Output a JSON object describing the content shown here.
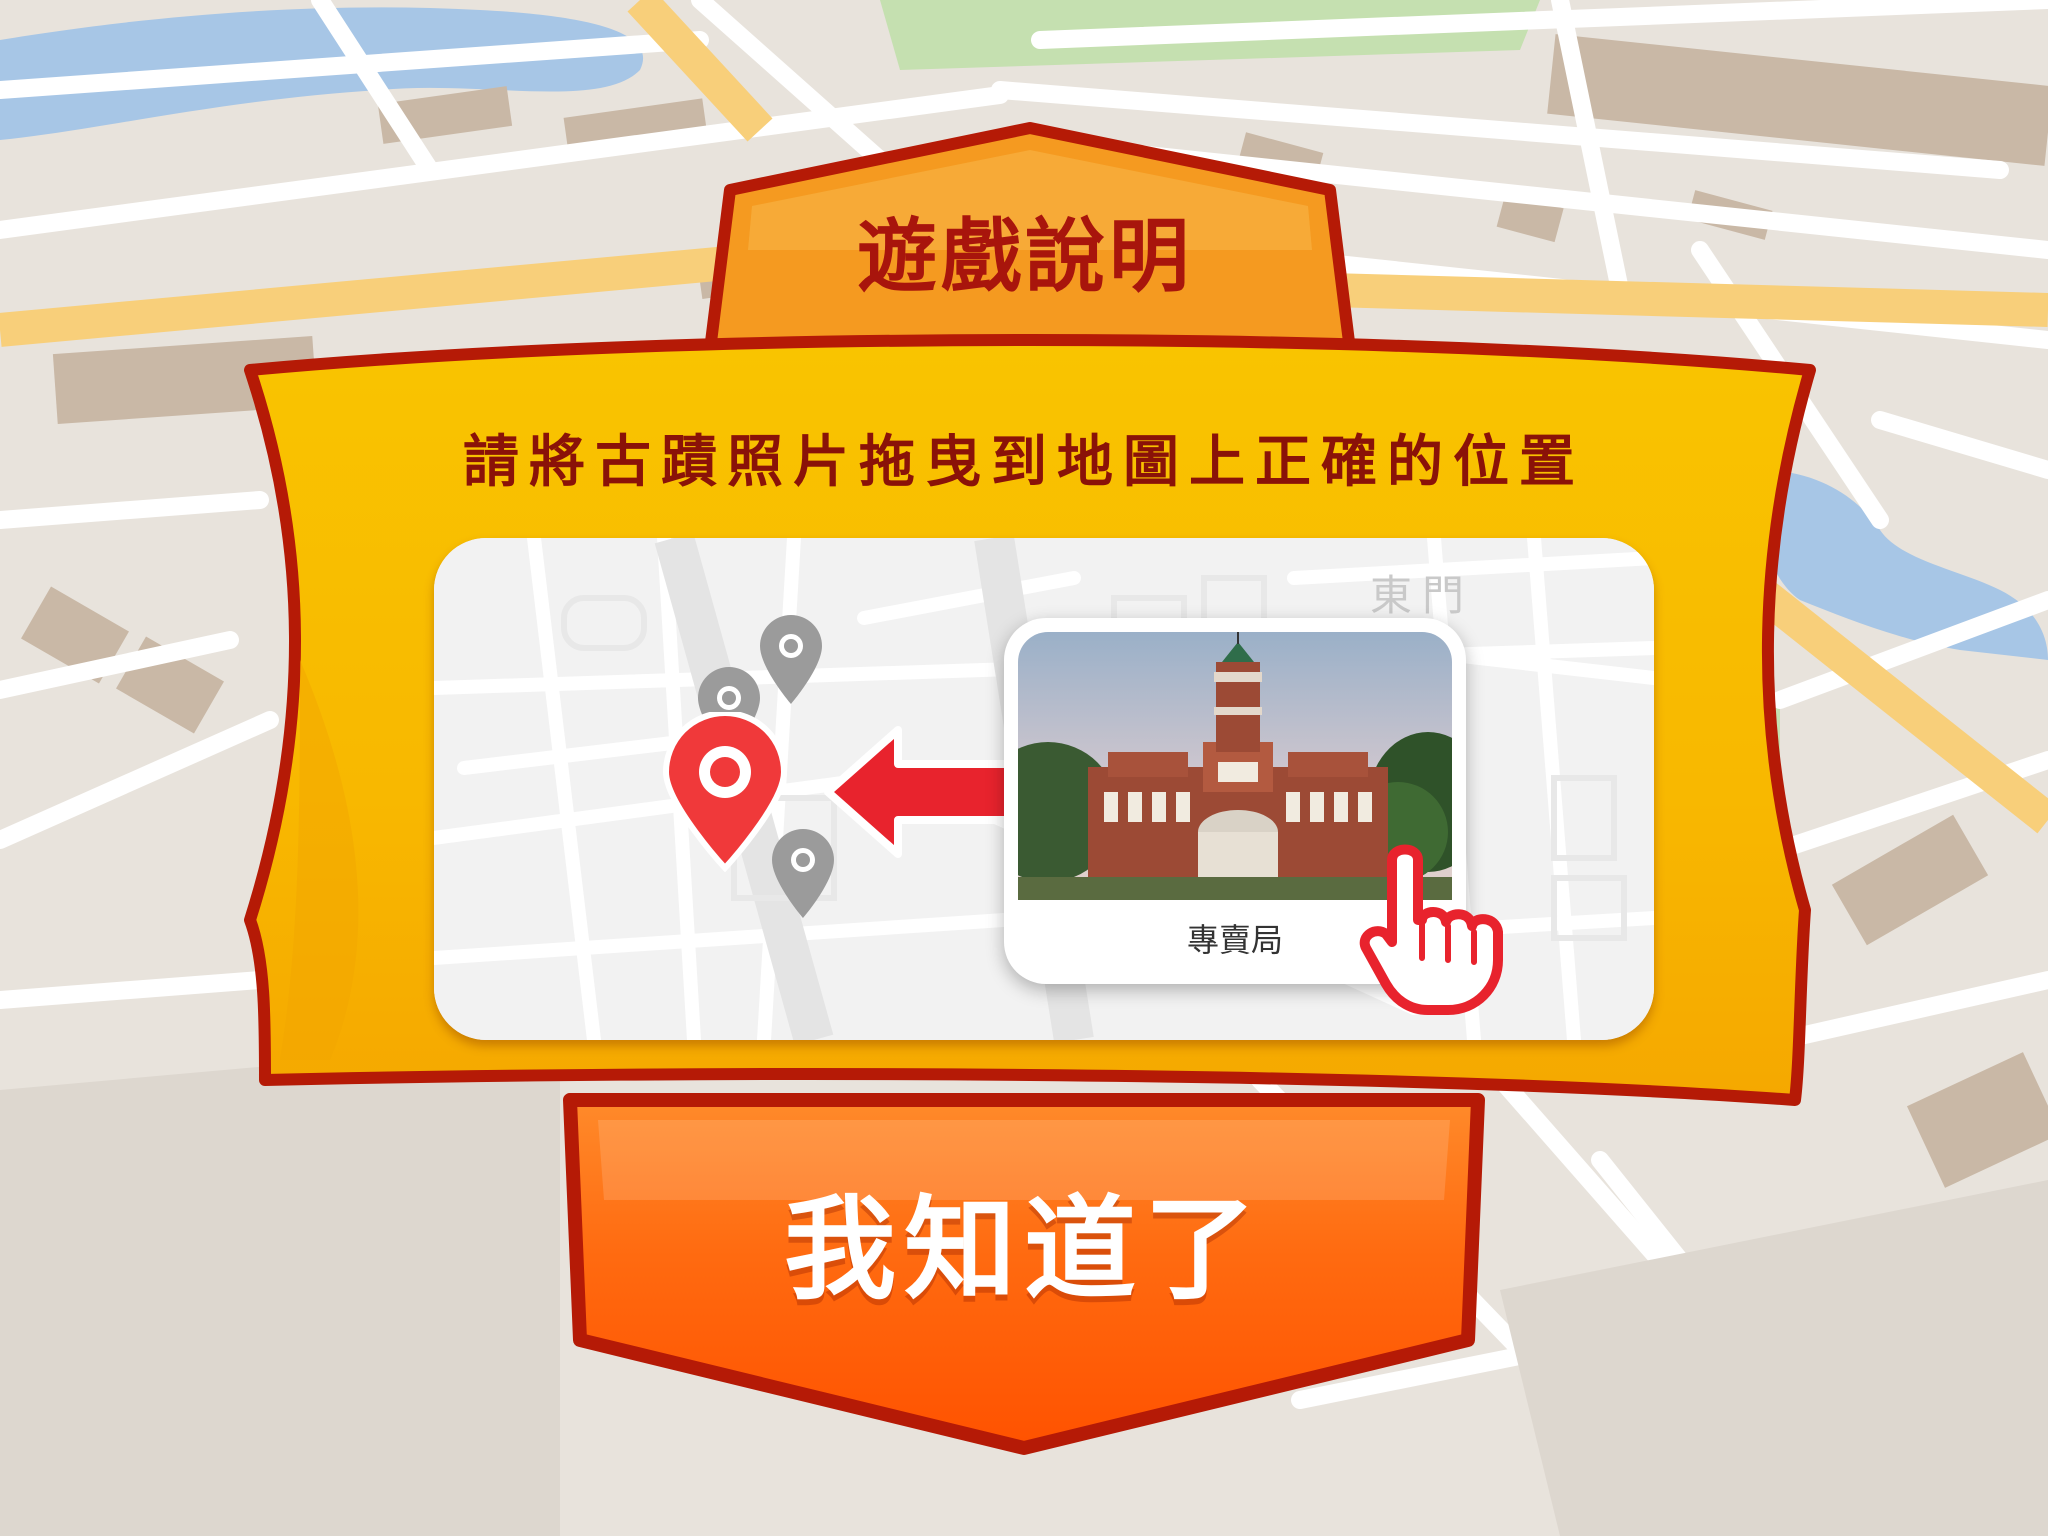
{
  "dialog": {
    "title": "遊戲說明",
    "instruction": "請將古蹟照片拖曳到地圖上正確的位置"
  },
  "demo": {
    "map_label": "東門",
    "photo_caption": "專賣局",
    "pins": [
      "map-pin-icon",
      "map-pin-icon",
      "map-pin-icon",
      "map-pin-icon"
    ],
    "selected_pin": "map-pin-active-icon"
  },
  "confirm_button": {
    "label": "我知道了"
  },
  "colors": {
    "banner_yellow": "#f8b800",
    "banner_border": "#b51a06",
    "button_orange": "#ff5a00",
    "title_tab_orange": "#f59a20",
    "title_text": "#a8150c",
    "pin_red": "#f0393a",
    "arrow_red": "#e8232d"
  }
}
